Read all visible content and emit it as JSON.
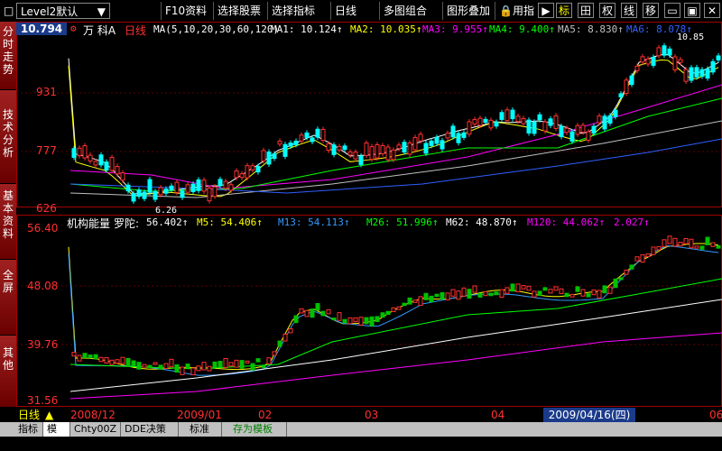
{
  "toolbar": {
    "layout_select": "Level2默认",
    "f10": "F10资料",
    "select_stock": "选择股票",
    "select_indicator": "选择指标",
    "period": "日线",
    "multi_combo": "多图组合",
    "overlay": "图形叠加",
    "use_indicator": "用指",
    "btn_mark": "标",
    "btn_grid": "田",
    "btn_rights": "权",
    "btn_line": "线",
    "btn_move": "移"
  },
  "left_tabs": [
    "分时走势",
    "技术分析",
    "基本资料",
    "全屏",
    "其他"
  ],
  "price_panel": {
    "current_price": "10.794",
    "stock_name": "万  科A",
    "period": "日线",
    "ma_label": "MA(5,10,20,30,60,120)",
    "ma1": "MA1: 10.124↑",
    "ma2": "MA2: 10.035↑",
    "ma3": "MA3: 9.955↑",
    "ma4": "MA4: 9.400↑",
    "ma5": "MA5: 8.830↑",
    "ma6": "MA6: 8.078↑",
    "y_labels": [
      "931",
      "777",
      "626"
    ],
    "low_annotation": "6.26",
    "high_annotation": "10.85"
  },
  "indicator_panel": {
    "name": "机构能量",
    "stock": "罗陀:",
    "value": "56.402↑",
    "m5": "M5: 54.406↑",
    "m13": "M13: 54.113↑",
    "m26": "M26: 51.996↑",
    "m62": "M62: 48.870↑",
    "m120": "M120: 44.062↑",
    "extra": "2.027↑",
    "y_labels": [
      "56.40",
      "48.08",
      "39.76",
      "31.56"
    ]
  },
  "date_bar": {
    "period_label": "日线",
    "labels": [
      "2008/12",
      "2009/01",
      "02",
      "03",
      "04",
      "06"
    ],
    "cursor_date": "2009/04/16(四)"
  },
  "bottom_tabs": [
    "指标",
    "模板",
    "Chty00Z",
    "DDE决策",
    "标准",
    "存为模板"
  ],
  "colors": {
    "up": "#ff3030",
    "down": "#00ffff",
    "ma1": "#ffffff",
    "ma2": "#ffff00",
    "ma3": "#ff00ff",
    "ma4": "#00ff00",
    "ma5": "#c0c0c0",
    "ma6": "#3060ff",
    "m13": "#3399ff"
  }
}
